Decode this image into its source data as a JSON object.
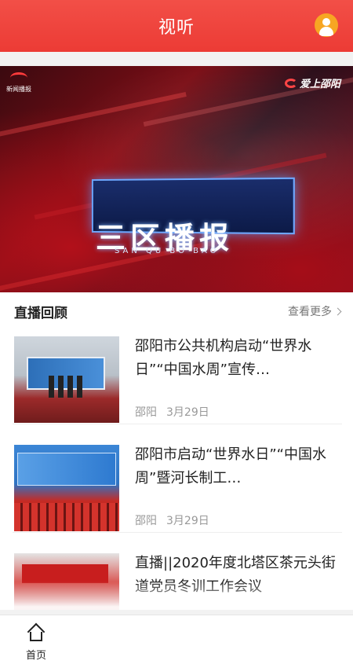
{
  "header": {
    "title": "视听",
    "avatar_icon": "user-avatar-icon",
    "bg_color": "#ec3b35"
  },
  "banner": {
    "title_text": "三区播报",
    "subtitle_text": "SAN QU BO BAO",
    "logo_left_text": "新闻播报",
    "logo_right_text": "爱上邵阳"
  },
  "section": {
    "title": "直播回顾",
    "more_label": "查看更多"
  },
  "items": [
    {
      "title": "邵阳市公共机构启动“世界水日”“中国水周”宣传…",
      "source": "邵阳",
      "date": "3月29日"
    },
    {
      "title": "邵阳市启动“世界水日”“中国水周”暨河长制工…",
      "source": "邵阳",
      "date": "3月29日"
    },
    {
      "title": "直播||2020年度北塔区茶元头街道党员冬训工作会议"
    }
  ],
  "tabbar": {
    "home_label": "首页",
    "home_icon": "home-icon"
  }
}
